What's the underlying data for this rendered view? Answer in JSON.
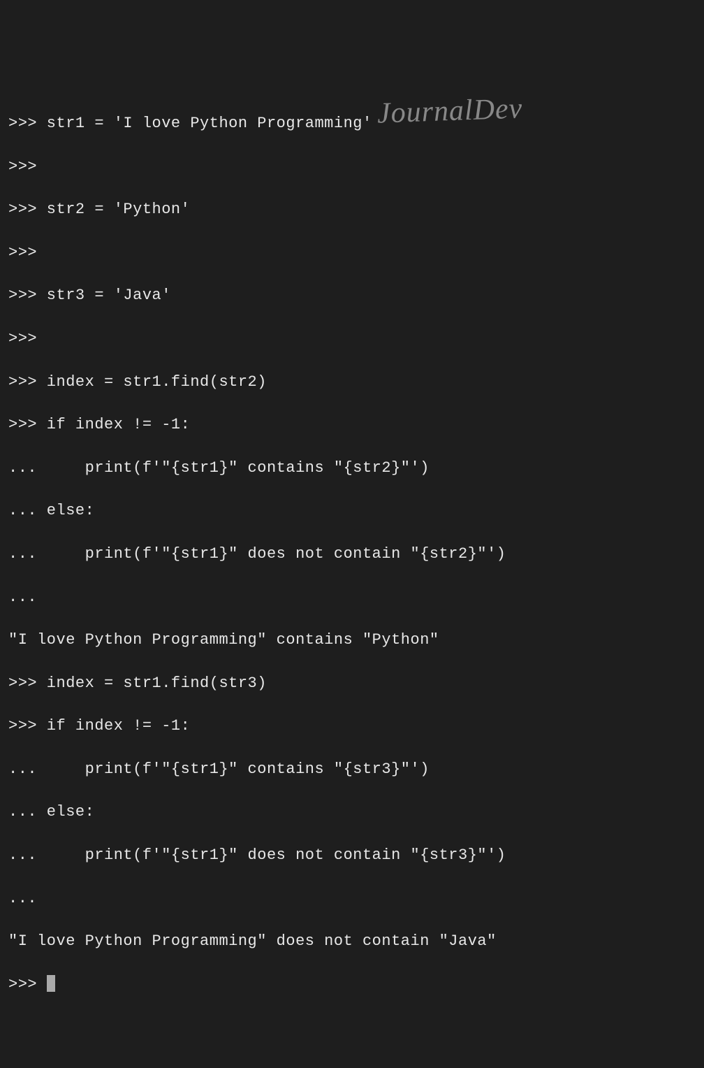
{
  "watermark": "JournalDev",
  "lines": [
    ">>> str1 = 'I love Python Programming'",
    ">>> ",
    ">>> str2 = 'Python'",
    ">>> ",
    ">>> str3 = 'Java'",
    ">>> ",
    ">>> index = str1.find(str2)",
    ">>> if index != -1:",
    "...     print(f'\"{str1}\" contains \"{str2}\"')",
    "... else:",
    "...     print(f'\"{str1}\" does not contain \"{str2}\"')",
    "... ",
    "\"I love Python Programming\" contains \"Python\"",
    ">>> index = str1.find(str3)",
    ">>> if index != -1:",
    "...     print(f'\"{str1}\" contains \"{str3}\"')",
    "... else:",
    "...     print(f'\"{str1}\" does not contain \"{str3}\"')",
    "... ",
    "\"I love Python Programming\" does not contain \"Java\"",
    ">>> "
  ],
  "prompt": ">>> "
}
